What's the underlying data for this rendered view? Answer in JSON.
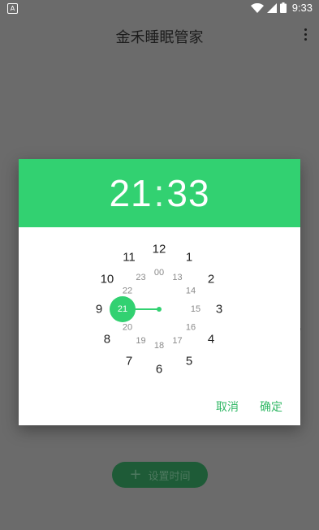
{
  "status_bar": {
    "time": "9:33",
    "notification": "A"
  },
  "app_bar": {
    "title": "金禾睡眠管家"
  },
  "dialog": {
    "hour": "21",
    "separator": ":",
    "minute": "33",
    "cancel_label": "取消",
    "ok_label": "确定",
    "selected_hour": "21"
  },
  "clock": {
    "outer_hours": [
      "12",
      "1",
      "2",
      "3",
      "4",
      "5",
      "6",
      "7",
      "8",
      "9",
      "10",
      "11"
    ],
    "inner_hours": [
      "00",
      "13",
      "14",
      "15",
      "16",
      "17",
      "18",
      "19",
      "20",
      "21",
      "22",
      "23"
    ]
  },
  "main": {
    "set_time_label": "设置时间"
  },
  "colors": {
    "accent": "#32d171",
    "button_dim": "#1e5b37",
    "scrim": "#6b6b6b"
  }
}
